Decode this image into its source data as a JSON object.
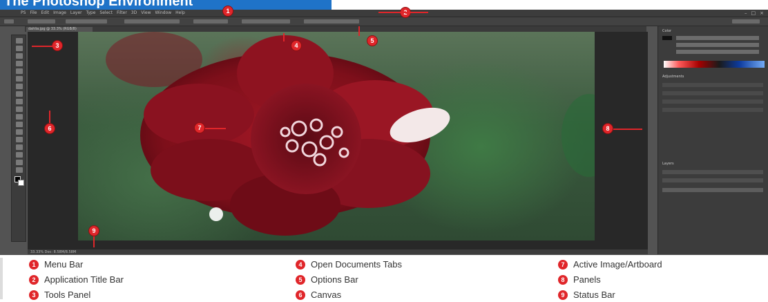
{
  "banner": {
    "title": "The Photoshop Environment"
  },
  "app": {
    "menu": [
      "PS",
      "File",
      "Edit",
      "Image",
      "Layer",
      "Type",
      "Select",
      "Filter",
      "3D",
      "View",
      "Window",
      "Help"
    ],
    "window_controls": [
      "–",
      "□",
      "×"
    ],
    "document_tab": "dahlia.jpg @ 33.3% (RGB/8)",
    "status": "33.33%   Doc: 8.58M/8.58M",
    "panels": {
      "color_label": "Color",
      "adjustments_label": "Adjustments",
      "layers_label": "Layers"
    }
  },
  "callouts": [
    "1",
    "2",
    "3",
    "4",
    "5",
    "6",
    "7",
    "8",
    "9"
  ],
  "legend": [
    {
      "num": "1",
      "label": "Menu Bar"
    },
    {
      "num": "2",
      "label": "Application Title Bar"
    },
    {
      "num": "3",
      "label": "Tools Panel"
    },
    {
      "num": "4",
      "label": "Open Documents Tabs"
    },
    {
      "num": "5",
      "label": "Options Bar"
    },
    {
      "num": "6",
      "label": "Canvas"
    },
    {
      "num": "7",
      "label": "Active Image/Artboard"
    },
    {
      "num": "8",
      "label": "Panels"
    },
    {
      "num": "9",
      "label": "Status Bar"
    }
  ],
  "colors": {
    "accent": "#e0262a",
    "banner": "#1f73c8",
    "ps_dark": "#3c3c3c"
  }
}
